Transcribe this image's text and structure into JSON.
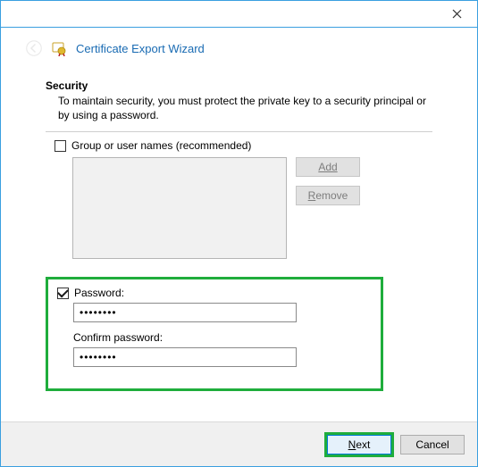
{
  "window": {
    "title": "Certificate Export Wizard"
  },
  "security": {
    "heading": "Security",
    "description": "To maintain security, you must protect the private key to a security principal or by using a password.",
    "group_checkbox_label": "Group or user names (recommended)",
    "group_checked": false,
    "add_label": "Add",
    "remove_label": "Remove"
  },
  "password": {
    "checked": true,
    "label": "Password:",
    "value": "••••••••",
    "confirm_label": "Confirm password:",
    "confirm_value": "••••••••"
  },
  "footer": {
    "next_label": "Next",
    "cancel_label": "Cancel"
  }
}
